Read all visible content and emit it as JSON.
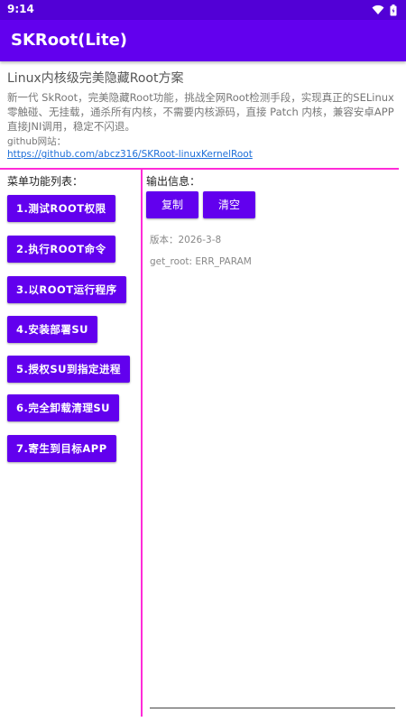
{
  "status_bar": {
    "time": "9:14",
    "icons": [
      "wifi-icon",
      "battery-icon"
    ]
  },
  "app_bar": {
    "title": "SKRoot(Lite)"
  },
  "header": {
    "title": "Linux内核级完美隐藏Root方案",
    "description": "新一代 SkRoot，完美隐藏Root功能，挑战全网Root检测手段，实现真正的SELinux零触碰、无挂载，通杀所有内核，不需要内核源码，直接 Patch 内核，兼容安卓APP 直接JNI调用，稳定不闪退。",
    "github_label": "github网站：",
    "github_link": "https://github.com/abcz316/SKRoot-linuxKernelRoot"
  },
  "menu": {
    "title": "菜单功能列表：",
    "buttons": [
      "1.测试ROOT权限",
      "2.执行ROOT命令",
      "3.以ROOT运行程序",
      "4.安装部署SU",
      "5.授权SU到指定进程",
      "6.完全卸载清理SU",
      "7.寄生到目标APP"
    ]
  },
  "output": {
    "title": "输出信息：",
    "copy_label": "复制",
    "clear_label": "清空",
    "lines": [
      "版本：2026-3-8",
      "get_root: ERR_PARAM"
    ]
  },
  "colors": {
    "primary": "#6200ee",
    "status_bar": "#5200d6",
    "divider": "#ff2bd8",
    "link": "#1e6fd8"
  }
}
